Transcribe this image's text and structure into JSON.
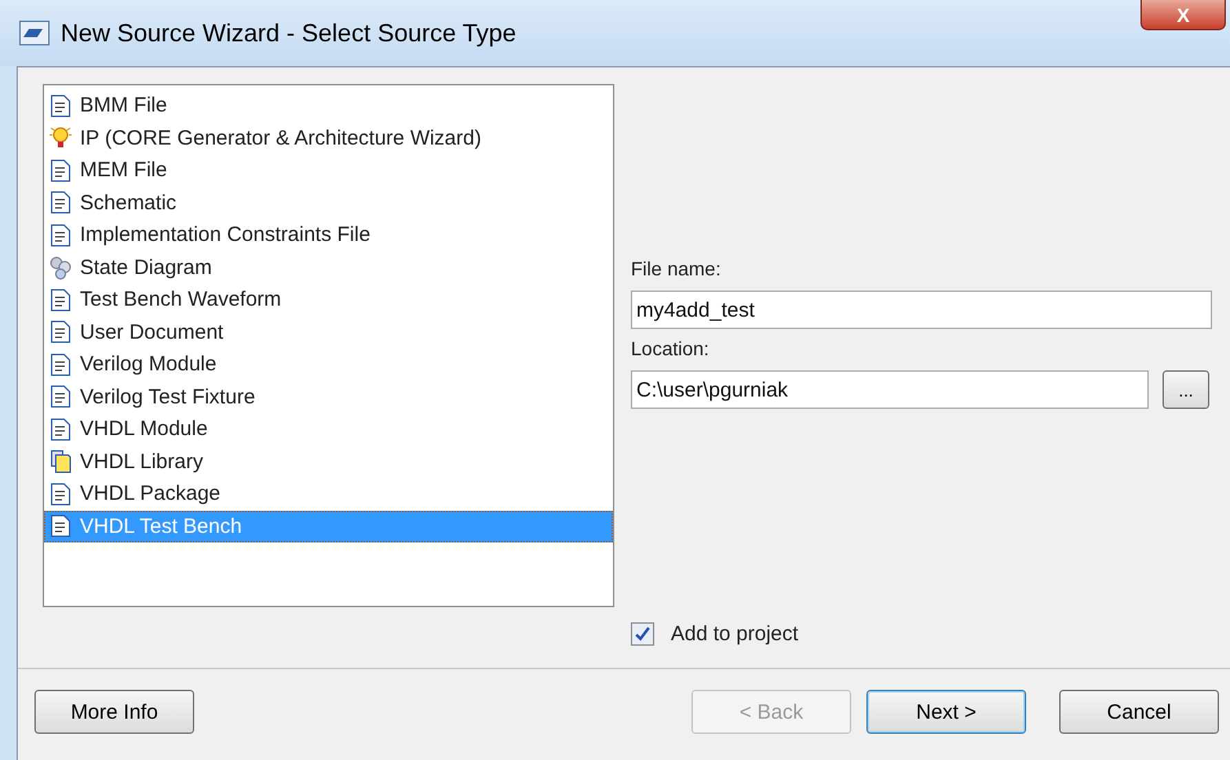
{
  "window": {
    "title": "New Source Wizard - Select Source Type",
    "close_label": "X"
  },
  "source_types": [
    {
      "label": "BMM File",
      "kind": "document",
      "selected": false
    },
    {
      "label": "IP (CORE Generator & Architecture Wizard)",
      "kind": "bulb",
      "selected": false
    },
    {
      "label": "MEM File",
      "kind": "document",
      "selected": false
    },
    {
      "label": "Schematic",
      "kind": "document",
      "selected": false
    },
    {
      "label": "Implementation Constraints File",
      "kind": "document",
      "selected": false
    },
    {
      "label": "State Diagram",
      "kind": "bubbles",
      "selected": false
    },
    {
      "label": "Test Bench Waveform",
      "kind": "document",
      "selected": false
    },
    {
      "label": "User Document",
      "kind": "document",
      "selected": false
    },
    {
      "label": "Verilog Module",
      "kind": "document",
      "selected": false
    },
    {
      "label": "Verilog Test Fixture",
      "kind": "document",
      "selected": false
    },
    {
      "label": "VHDL Module",
      "kind": "document",
      "selected": false
    },
    {
      "label": "VHDL Library",
      "kind": "library",
      "selected": false
    },
    {
      "label": "VHDL Package",
      "kind": "document",
      "selected": false
    },
    {
      "label": "VHDL Test Bench",
      "kind": "document",
      "selected": true
    }
  ],
  "file_name": {
    "label": "File name:",
    "value": "my4add_test"
  },
  "location": {
    "label": "Location:",
    "value": "C:\\user\\pgurniak",
    "browse": "..."
  },
  "add_to_project": {
    "label": "Add to project",
    "checked": true
  },
  "buttons": [
    {
      "label": "More Info",
      "disabled": false,
      "default": false
    },
    {
      "label": "< Back",
      "disabled": true,
      "default": false
    },
    {
      "label": "Next >",
      "disabled": false,
      "default": true
    },
    {
      "label": "Cancel",
      "disabled": false,
      "default": false
    }
  ]
}
